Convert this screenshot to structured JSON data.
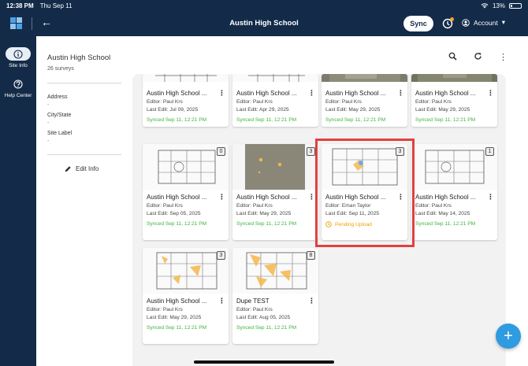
{
  "status_bar": {
    "time": "12:38 PM",
    "date": "Thu Sep 11",
    "battery": "13%"
  },
  "app_bar": {
    "title": "Austin High School",
    "sync_label": "Sync",
    "account_label": "Account"
  },
  "nav_rail": {
    "items": [
      {
        "label": "Site Info",
        "icon": "info-icon"
      },
      {
        "label": "Help Center",
        "icon": "help-icon"
      }
    ]
  },
  "site": {
    "name": "Austin High School",
    "survey_count": "26 surveys",
    "fields": [
      {
        "label": "Address",
        "value": "-"
      },
      {
        "label": "City/State",
        "value": "-"
      },
      {
        "label": "Site Label",
        "value": "-"
      }
    ],
    "edit_label": "Edit Info"
  },
  "cards": [
    {
      "name": "Austin High School ...",
      "editor": "Editor: Paul Krs",
      "last_edit": "Last Edit: Jul 09, 2025",
      "status": "Synced Sep 11, 12:21 PM"
    },
    {
      "name": "Austin High School ...",
      "editor": "Editor: Paul Krs",
      "last_edit": "Last Edit: Apr 29, 2025",
      "status": "Synced Sep 11, 12:21 PM"
    },
    {
      "name": "Austin High School ...",
      "editor": "Editor: Paul Krs",
      "last_edit": "Last Edit: May 29, 2025",
      "status": "Synced Sep 11, 12:21 PM"
    },
    {
      "name": "Austin High School ...",
      "editor": "Editor: Paul Krs",
      "last_edit": "Last Edit: May 29, 2025",
      "status": "Synced Sep 11, 12:21 PM"
    },
    {
      "name": "Austin High School ...",
      "editor": "Editor: Paul Krs",
      "last_edit": "Last Edit: Sep 05, 2025",
      "status": "Synced Sep 11, 12:21 PM",
      "badge": "0"
    },
    {
      "name": "Austin High School ...",
      "editor": "Editor: Paul Krs",
      "last_edit": "Last Edit: May 29, 2025",
      "status": "Synced Sep 11, 12:21 PM",
      "badge": "3"
    },
    {
      "name": "Austin High School ...",
      "editor": "Editor: Eman Taylor",
      "last_edit": "Last Edit: Sep 11, 2025",
      "status": "Pending Upload",
      "badge": "3"
    },
    {
      "name": "Austin High School ...",
      "editor": "Editor: Paul Krs",
      "last_edit": "Last Edit: May 14, 2025",
      "status": "Synced Sep 11, 12:21 PM",
      "badge": "1"
    },
    {
      "name": "Austin High School ...",
      "editor": "Editor: Paul Krs",
      "last_edit": "Last Edit: May 29, 2025",
      "status": "Synced Sep 11, 12:21 PM",
      "badge": "3"
    },
    {
      "name": "Dupe TEST",
      "editor": "Editor: Paul Krs",
      "last_edit": "Last Edit: Aug 05, 2025",
      "status": "Synced Sep 11, 12:21 PM",
      "badge": "8"
    }
  ],
  "colors": {
    "nav_bg": "#132b49",
    "synced": "#3fb43f",
    "pending": "#f0a000",
    "highlight": "#e2403e",
    "fab": "#2f9be0"
  }
}
